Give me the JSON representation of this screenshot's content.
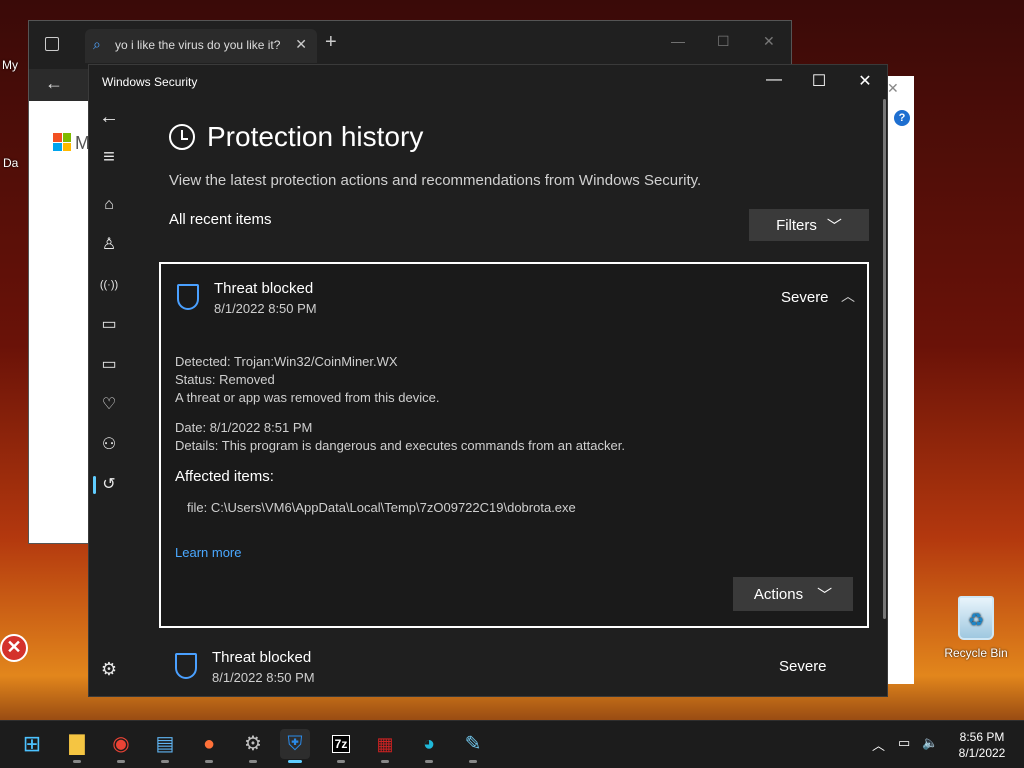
{
  "desktop": {
    "partial_labels": [
      "My",
      "Da"
    ],
    "recycle_bin": "Recycle Bin"
  },
  "browser": {
    "tab_title": "yo i like the virus do you like it?",
    "logo_partial": "M"
  },
  "window": {
    "title": "Windows Security",
    "minimize": "—",
    "maximize": "☐",
    "close": "✕"
  },
  "sidebar": {
    "items": [
      {
        "name": "back",
        "glyph": "←"
      },
      {
        "name": "menu",
        "glyph": "≡"
      },
      {
        "name": "home",
        "glyph": "⌂"
      },
      {
        "name": "account",
        "glyph": "♙"
      },
      {
        "name": "firewall",
        "glyph": "((·))"
      },
      {
        "name": "app-browser",
        "glyph": "▭"
      },
      {
        "name": "device-security",
        "glyph": "▭"
      },
      {
        "name": "device-health",
        "glyph": "♡"
      },
      {
        "name": "family",
        "glyph": "⚇"
      },
      {
        "name": "history",
        "glyph": "↺"
      },
      {
        "name": "settings",
        "glyph": "⚙"
      }
    ]
  },
  "page": {
    "title": "Protection history",
    "subtitle": "View the latest protection actions and recommendations from Windows Security.",
    "section": "All recent items",
    "filters_label": "Filters"
  },
  "threats": [
    {
      "title": "Threat blocked",
      "date": "8/1/2022 8:50 PM",
      "severity": "Severe",
      "detected_label": "Detected:",
      "detected": "Trojan:Win32/CoinMiner.WX",
      "status_label": "Status:",
      "status": "Removed",
      "message": "A threat or app was removed from this device.",
      "date_label": "Date:",
      "detail_date": "8/1/2022 8:51 PM",
      "details_label": "Details:",
      "details": "This program is dangerous and executes commands from an attacker.",
      "affected_label": "Affected items:",
      "file": "file: C:\\Users\\VM6\\AppData\\Local\\Temp\\7zO09722C19\\dobrota.exe",
      "learn_more": "Learn more",
      "actions_label": "Actions"
    },
    {
      "title": "Threat blocked",
      "date": "8/1/2022 8:50 PM",
      "severity": "Severe"
    }
  ],
  "taskbar": {
    "apps": [
      "start",
      "file-explorer",
      "chrome",
      "notepad",
      "firefox",
      "settings",
      "windows-security",
      "7zip",
      "winrar",
      "edge",
      "paint"
    ],
    "seven_zip_label": "7z",
    "time": "8:56 PM",
    "date": "8/1/2022"
  }
}
